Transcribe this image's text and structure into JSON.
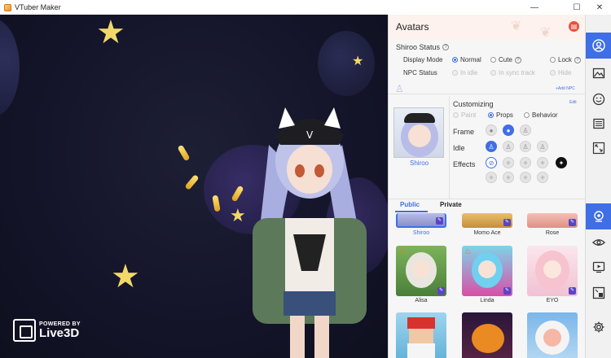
{
  "window": {
    "title": "VTuber Maker",
    "minimize": "—",
    "maximize": "☐",
    "close": "✕"
  },
  "branding": {
    "powered": "POWERED BY",
    "name": "Live3D"
  },
  "panel": {
    "title": "Avatars",
    "status_title": "Shiroo Status",
    "display_mode_label": "Display Mode",
    "display_modes": [
      "Normal",
      "Cute",
      "Lock"
    ],
    "npc_status_label": "NPC Status",
    "npc_options": [
      "In idle",
      "In sync track",
      "Hide"
    ],
    "add_npc": "+Add NPC",
    "edit": "Edit",
    "selected_avatar": "Shiroo",
    "customizing_label": "Customizing",
    "customizing_options": [
      "Paint",
      "Props",
      "Behavior"
    ],
    "frame_label": "Frame",
    "idle_label": "Idle",
    "effects_label": "Effects",
    "tabs": [
      "Public",
      "Private"
    ],
    "cards_row1": [
      "Shiroo",
      "Momo Ace",
      "Rose"
    ],
    "cards_row2": [
      "Alisa",
      "Linda",
      "EYO"
    ]
  },
  "colors": {
    "accent": "#3f6fe6",
    "close": "#e6533a",
    "scene": "#14152a"
  }
}
